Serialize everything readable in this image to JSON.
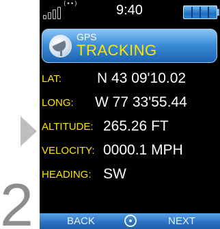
{
  "step": {
    "number": "2"
  },
  "status_bar": {
    "gps_signal_label": "(••)",
    "time": "9:40",
    "icons": [
      "signal-strength-icon",
      "battery-icon"
    ]
  },
  "mode": {
    "icon": "satellite-dish-icon",
    "title": "GPS",
    "subtitle": "TRACKING"
  },
  "readouts": [
    {
      "label": "LAT:",
      "value": "N 43 09'10.02"
    },
    {
      "label": "LONG:",
      "value": "W 77 33'55.44"
    },
    {
      "label": "ALTITUDE:",
      "value": "265.26 FT"
    },
    {
      "label": "VELOCITY:",
      "value": "0000.1 MPH"
    },
    {
      "label": "HEADING:",
      "value": "SW"
    }
  ],
  "softkeys": {
    "left": "BACK",
    "center_icon": "select-center-icon",
    "right": "NEXT"
  },
  "colors": {
    "label": "#ffe400",
    "value": "#ffffff",
    "accent": "#2b74c4",
    "background": "#000000"
  }
}
